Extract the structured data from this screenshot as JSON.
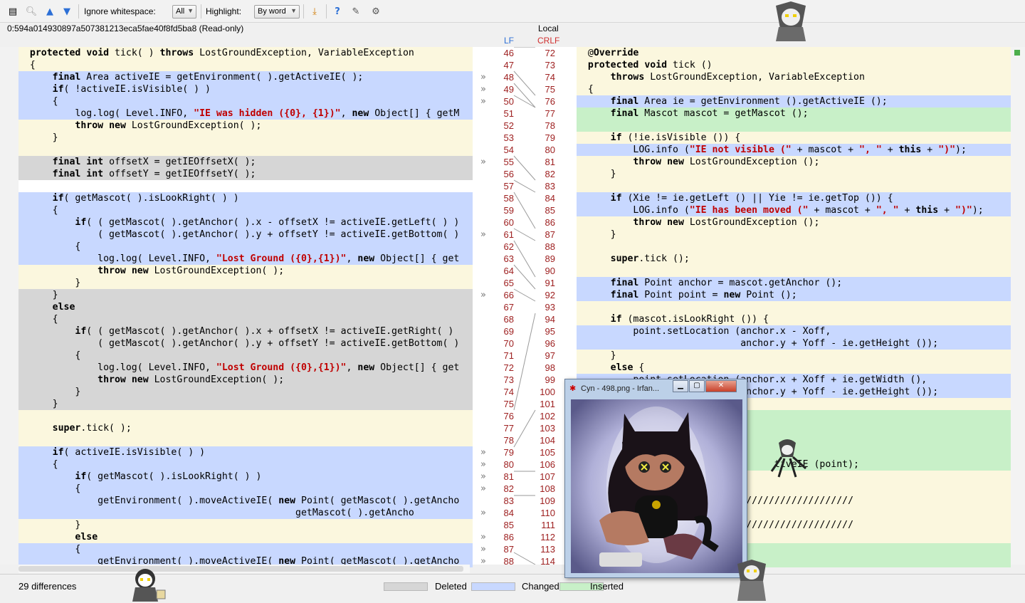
{
  "toolbar": {
    "ignore_whitespace_label": "Ignore whitespace:",
    "ignore_whitespace_value": "All",
    "highlight_label": "Highlight:",
    "highlight_value": "By word"
  },
  "revision": "0:594a014930897a507381213eca5fae40f8fd5ba8 (Read-only)",
  "left_header": {
    "line_ending": "LF"
  },
  "right_header": {
    "title": "Local",
    "line_ending": "CRLF"
  },
  "left_lines": [
    "  protected void tick( ) throws LostGroundException, VariableException",
    "  {",
    "      final Area activeIE = getEnvironment( ).getActiveIE( );",
    "      if( !activeIE.isVisible( ) )",
    "      {",
    "          log.log( Level.INFO, \"IE was hidden ({0}, {1})\", new Object[] { getM",
    "          throw new LostGroundException( );",
    "      }",
    "",
    "      final int offsetX = getIEOffsetX( );",
    "      final int offsetY = getIEOffsetY( );",
    "",
    "      if( getMascot( ).isLookRight( ) )",
    "      {",
    "          if( ( getMascot( ).getAnchor( ).x - offsetX != activeIE.getLeft( ) )",
    "              ( getMascot( ).getAnchor( ).y + offsetY != activeIE.getBottom( )",
    "          {",
    "              log.log( Level.INFO, \"Lost Ground ({0},{1})\", new Object[] { get",
    "              throw new LostGroundException( );",
    "          }",
    "      }",
    "      else",
    "      {",
    "          if( ( getMascot( ).getAnchor( ).x + offsetX != activeIE.getRight( )",
    "              ( getMascot( ).getAnchor( ).y + offsetY != activeIE.getBottom( )",
    "          {",
    "              log.log( Level.INFO, \"Lost Ground ({0},{1})\", new Object[] { get",
    "              throw new LostGroundException( );",
    "          }",
    "      }",
    "",
    "      super.tick( );",
    "",
    "      if( activeIE.isVisible( ) )",
    "      {",
    "          if( getMascot( ).isLookRight( ) )",
    "          {",
    "              getEnvironment( ).moveActiveIE( new Point( getMascot( ).getAncho",
    "                                                 getMascot( ).getAncho",
    "          }",
    "          else",
    "          {",
    "              getEnvironment( ).moveActiveIE( new Point( getMascot( ).getAncho"
  ],
  "left_numbers": [
    "46",
    "47",
    "48",
    "49",
    "50",
    "51",
    "52",
    "53",
    "54",
    "55",
    "56",
    "57",
    "58",
    "59",
    "60",
    "61",
    "62",
    "63",
    "64",
    "65",
    "66",
    "67",
    "68",
    "69",
    "70",
    "71",
    "72",
    "73",
    "74",
    "75",
    "76",
    "77",
    "78",
    "79",
    "80",
    "81",
    "82",
    "83",
    "84",
    "85",
    "86",
    "87",
    "88"
  ],
  "right_lines": [
    "  @Override",
    "  protected void tick ()",
    "      throws LostGroundException, VariableException",
    "  {",
    "      final Area ie = getEnvironment ().getActiveIE ();",
    "      final Mascot mascot = getMascot ();",
    "",
    "      if (!ie.isVisible ()) {",
    "          LOG.info (\"IE not visible (\" + mascot + \", \" + this + \")\");",
    "          throw new LostGroundException ();",
    "      }",
    "",
    "      if (Xie != ie.getLeft () || Yie != ie.getTop ()) {",
    "          LOG.info (\"IE has been moved (\" + mascot + \", \" + this + \")\");",
    "          throw new LostGroundException ();",
    "      }",
    "",
    "      super.tick ();",
    "",
    "      final Point anchor = mascot.getAnchor ();",
    "      final Point point = new Point ();",
    "",
    "      if (mascot.isLookRight ()) {",
    "          point.setLocation (anchor.x - Xoff,",
    "                             anchor.y + Yoff - ie.getHeight ());",
    "      }",
    "      else {",
    "          point.setLocation (anchor.x + Xoff + ie.getWidth (),",
    "                             anchor.y + Yoff - ie.getHeight ());",
    "",
    "",
    "",
    "",
    "",
    "                                   tiveIE (point);",
    "",
    "",
    "      ///////////////////////////////////////////",
    "",
    "      ///////////////////////////////////////////",
    "",
    "",
    ""
  ],
  "right_numbers": [
    "72",
    "73",
    "74",
    "75",
    "76",
    "77",
    "78",
    "79",
    "80",
    "81",
    "82",
    "83",
    "84",
    "85",
    "86",
    "87",
    "88",
    "89",
    "90",
    "91",
    "92",
    "93",
    "94",
    "95",
    "96",
    "97",
    "98",
    "99",
    "100",
    "101",
    "102",
    "103",
    "104",
    "105",
    "106",
    "107",
    "108",
    "109",
    "110",
    "111",
    "112",
    "113",
    "114"
  ],
  "status": {
    "differences": "29 differences",
    "legend_deleted": "Deleted",
    "legend_changed": "Changed",
    "legend_inserted": "Inserted"
  },
  "image_window": {
    "title": "Cyn - 498.png - Irfan..."
  },
  "colors": {
    "unchanged": "#fbf7de",
    "deleted": "#d6d6d6",
    "changed": "#c8d8ff",
    "inserted": "#c8f0c8",
    "line_number": "#9e2020"
  }
}
